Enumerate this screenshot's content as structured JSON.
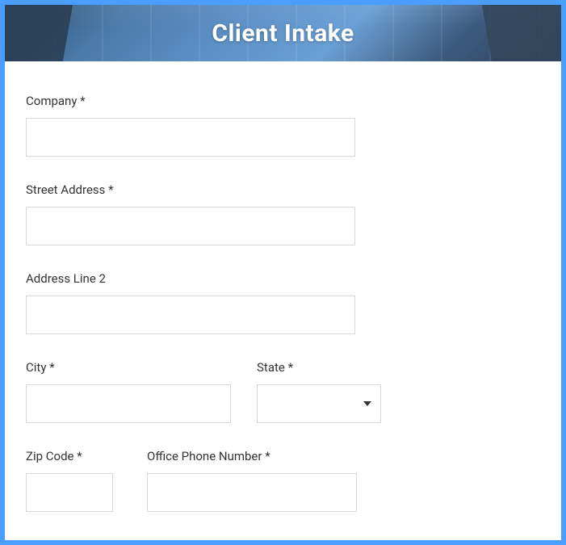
{
  "header": {
    "title": "Client Intake"
  },
  "form": {
    "company": {
      "label": "Company",
      "required": "*",
      "value": ""
    },
    "street_address": {
      "label": "Street Address",
      "required": "*",
      "value": ""
    },
    "address_line_2": {
      "label": "Address Line 2",
      "required": "",
      "value": ""
    },
    "city": {
      "label": "City",
      "required": "*",
      "value": ""
    },
    "state": {
      "label": "State",
      "required": "*",
      "value": ""
    },
    "zip_code": {
      "label": "Zip Code",
      "required": "*",
      "value": ""
    },
    "office_phone": {
      "label": "Office Phone Number",
      "required": "*",
      "value": ""
    }
  }
}
